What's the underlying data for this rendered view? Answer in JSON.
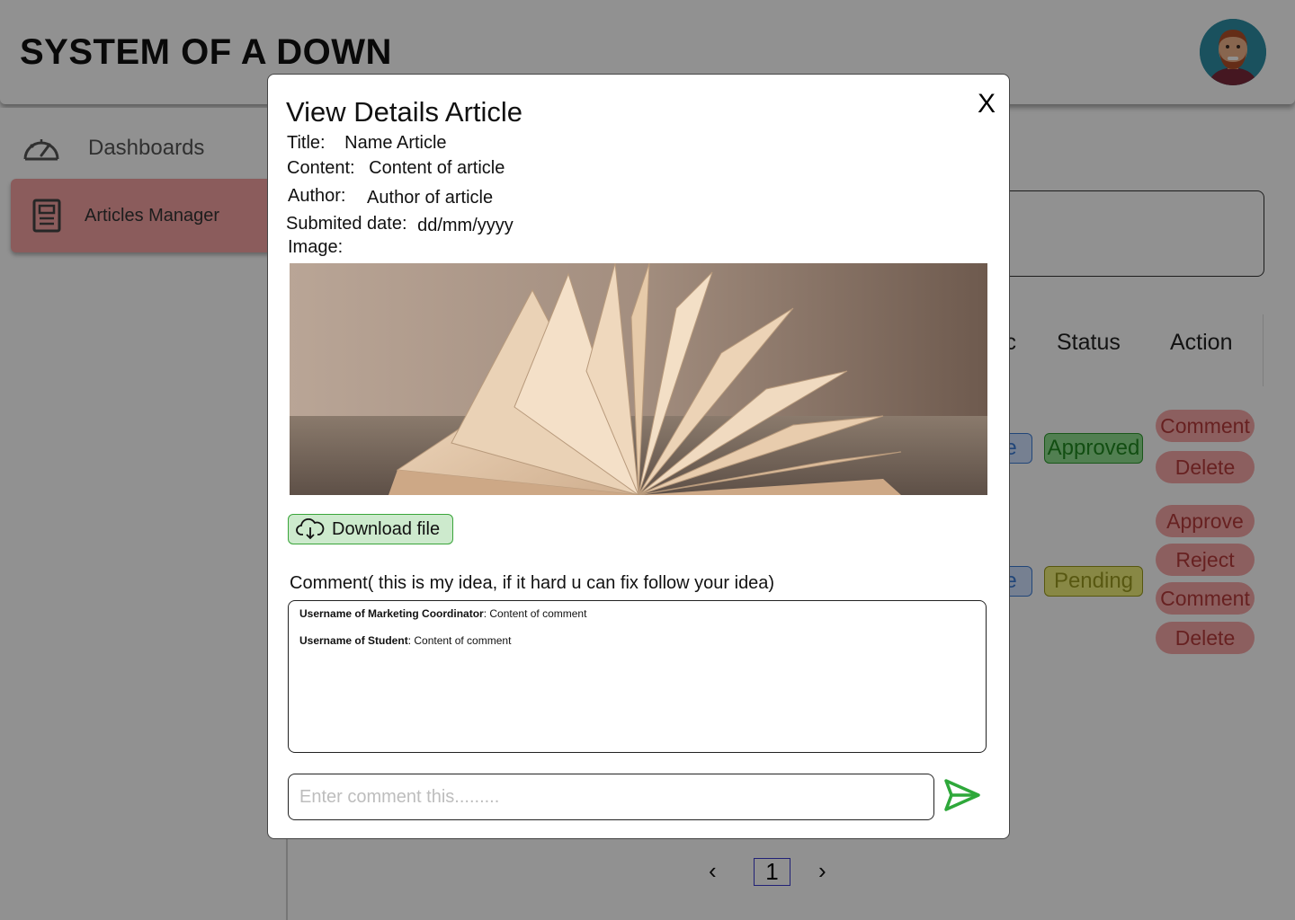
{
  "app": {
    "title": "SYSTEM OF A DOWN"
  },
  "sidebar": {
    "items": [
      {
        "label": "Dashboards",
        "icon": "speedometer-icon"
      },
      {
        "label": "Articles Manager",
        "icon": "document-icon",
        "active": true
      }
    ]
  },
  "table": {
    "headers": [
      "ic",
      "Status",
      "Action"
    ],
    "rows": [
      {
        "topic_fragment": "e",
        "status": "Approved",
        "status_color": "#8fe08f",
        "actions": [
          "Comment",
          "Delete"
        ]
      },
      {
        "topic_fragment": "e",
        "status": "Pending",
        "status_color": "#f0f07a",
        "actions": [
          "Approve",
          "Reject",
          "Comment",
          "Delete"
        ]
      }
    ]
  },
  "pagination": {
    "prev": "‹",
    "current": "1",
    "next": "›"
  },
  "modal": {
    "title": "View Details Article",
    "close_label": "X",
    "fields": {
      "title_label": "Title:",
      "title_value": "Name Article",
      "content_label": "Content:",
      "content_value": "Content of article",
      "author_label": "Author:",
      "author_value": "Author of article",
      "date_label": "Submited date:",
      "date_value": "dd/mm/yyyy",
      "image_label": "Image:"
    },
    "download_label": "Download file",
    "comment_heading": "Comment( this is my idea, if it hard u can fix follow your idea)",
    "comments": [
      {
        "user": "Username of Marketing Coordinator",
        "text": ": Content of comment"
      },
      {
        "user": "Username of Student",
        "text": ": Content of comment"
      }
    ],
    "comment_placeholder": "Enter comment this.........",
    "send_icon": "send-icon"
  },
  "colors": {
    "accent_red": "#f4a3a3",
    "download_green": "#cdeacd",
    "send_green": "#2ea83a"
  }
}
